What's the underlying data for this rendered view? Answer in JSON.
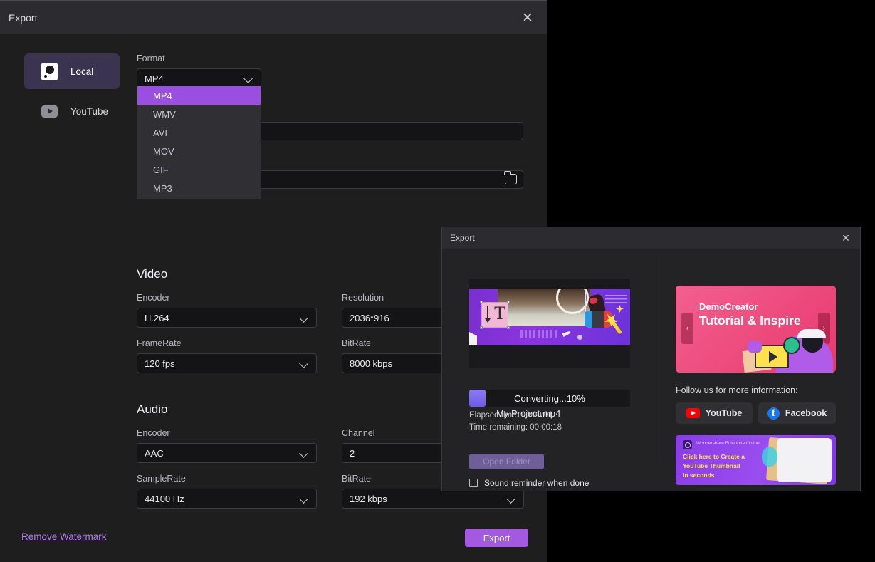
{
  "main_dialog": {
    "title": "Export",
    "close_icon": "✕",
    "sidebar": [
      {
        "label": "Local",
        "icon": "hard-drive-icon",
        "active": true
      },
      {
        "label": "YouTube",
        "icon": "youtube-icon",
        "active": false
      }
    ],
    "format": {
      "label": "Format",
      "value": "MP4",
      "options": [
        "MP4",
        "WMV",
        "AVI",
        "MOV",
        "GIF",
        "MP3"
      ],
      "selected_option": "MP4",
      "highlight_color": "#9b4fe0"
    },
    "name_field": {
      "value": "",
      "placeholder": ""
    },
    "path_field": {
      "value": "",
      "placeholder": "",
      "browse_icon": "folder-icon"
    },
    "video": {
      "title": "Video",
      "encoder": {
        "label": "Encoder",
        "value": "H.264"
      },
      "resolution": {
        "label": "Resolution",
        "value": "2036*916"
      },
      "framerate": {
        "label": "FrameRate",
        "value": "120 fps"
      },
      "bitrate": {
        "label": "BitRate",
        "value": "8000 kbps"
      }
    },
    "audio": {
      "title": "Audio",
      "encoder": {
        "label": "Encoder",
        "value": "AAC"
      },
      "channel": {
        "label": "Channel",
        "value": "2"
      },
      "samplerate": {
        "label": "SampleRate",
        "value": "44100 Hz"
      },
      "bitrate": {
        "label": "BitRate",
        "value": "192 kbps"
      }
    },
    "remove_watermark": "Remove Watermark",
    "export_button": "Export",
    "accent_color": "#a35ae0"
  },
  "progress_dialog": {
    "title": "Export",
    "close_icon": "✕",
    "file_name": "My Project.mp4",
    "progress_text": "Converting...10%",
    "progress_percent": 10,
    "elapsed_time": "Elapsed time: 00:00:01",
    "time_remaining": "Time remaining: 00:00:18",
    "open_folder_button": "Open Folder",
    "sound_reminder": {
      "label": "Sound reminder when done",
      "checked": false
    },
    "promo": {
      "banner_title": "DemoCreator",
      "banner_subtitle": "Tutorial & Inspire",
      "prev_arrow": "‹",
      "next_arrow": "›",
      "follow_label": "Follow us for more information:",
      "social": [
        {
          "label": "YouTube",
          "icon": "youtube-icon"
        },
        {
          "label": "Facebook",
          "icon": "facebook-icon"
        }
      ],
      "bottom_banner": {
        "brand": "Wondershare Fotophire Online",
        "line1": "Click here to Create a",
        "line2": "YouTube Thumbnail",
        "line3": "in seconds"
      }
    }
  }
}
